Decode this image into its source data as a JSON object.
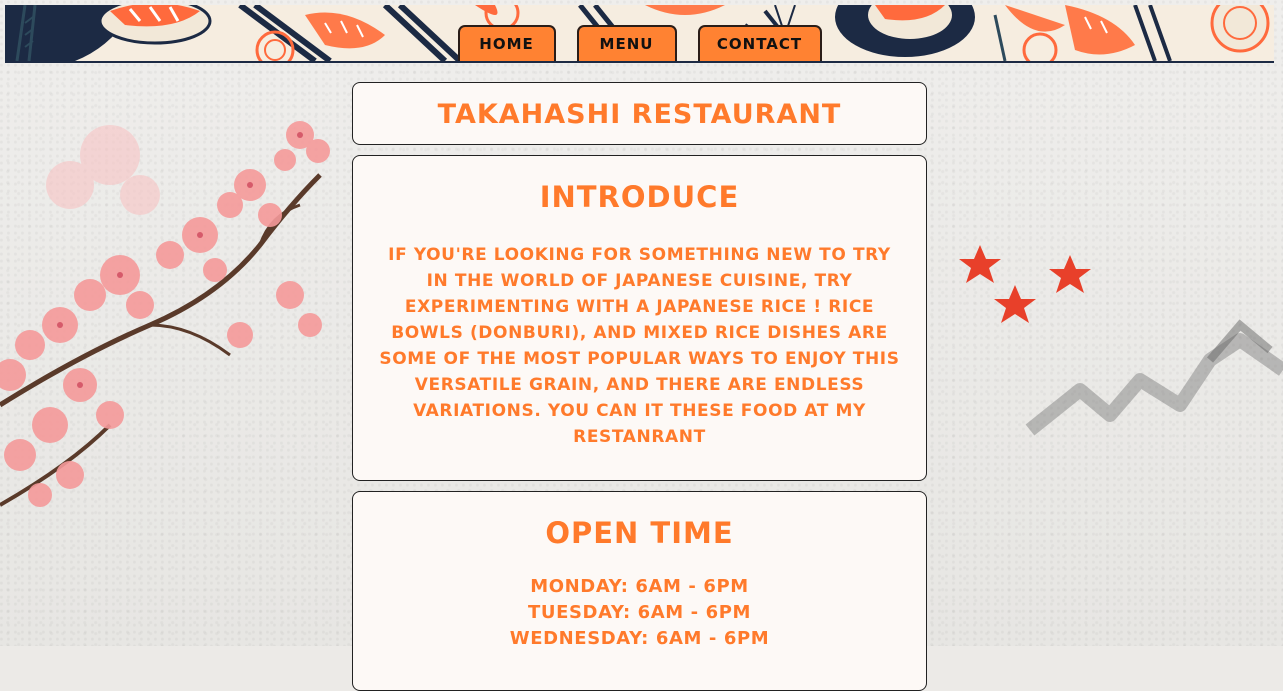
{
  "nav": {
    "items": [
      {
        "label": "Home"
      },
      {
        "label": "Menu"
      },
      {
        "label": "Contact"
      }
    ]
  },
  "restaurant": {
    "name": "Takahashi Restaurant"
  },
  "intro": {
    "heading": "Introduce",
    "body": "If you're looking for something new to try in the world of Japanese cuisine, try experimenting with a Japanese rice ! Rice bowls (donburi), and mixed rice dishes are some of the most popular ways to enjoy this versatile grain, and there are endless variations. You can it these food at my restanrant"
  },
  "open_time": {
    "heading": "Open Time",
    "hours": [
      "Monday: 6am - 6pm",
      "Tuesday: 6am - 6pm",
      "Wednesday: 6am - 6pm"
    ]
  },
  "colors": {
    "accent": "#ff7a2b",
    "nav_button": "#ff8232",
    "header_navy": "#1c2a44"
  }
}
